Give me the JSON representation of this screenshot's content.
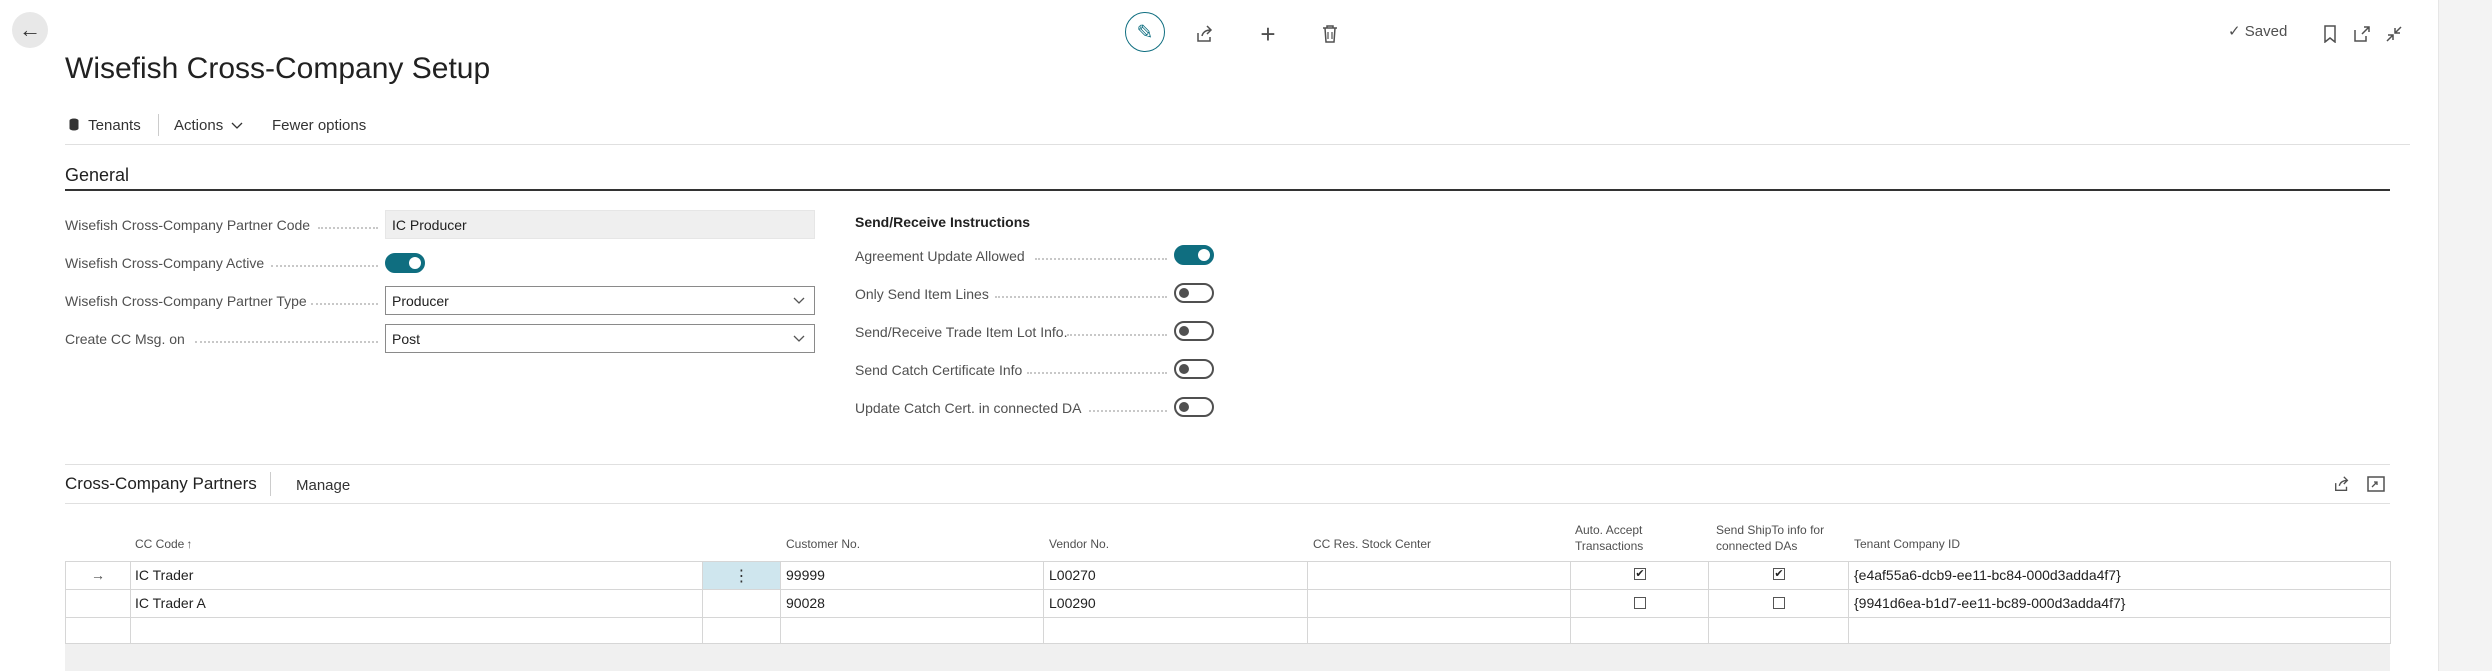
{
  "header": {
    "title": "Wisefish Cross-Company Setup",
    "saved_label": "Saved",
    "saved_check": "✓"
  },
  "actionbar": {
    "tenants_label": "Tenants",
    "actions_label": "Actions",
    "fewer_options_label": "Fewer options"
  },
  "general": {
    "section_title": "General",
    "partner_code_label": "Wisefish Cross-Company Partner Code",
    "partner_code_value": "IC Producer",
    "active_label": "Wisefish Cross-Company Active",
    "active_value": true,
    "partner_type_label": "Wisefish Cross-Company Partner Type",
    "partner_type_value": "Producer",
    "create_msg_label": "Create CC Msg. on",
    "create_msg_value": "Post"
  },
  "send_receive": {
    "heading": "Send/Receive Instructions",
    "items": [
      {
        "label": "Agreement Update Allowed",
        "on": true
      },
      {
        "label": "Only Send Item Lines",
        "on": false
      },
      {
        "label": "Send/Receive Trade Item Lot Info.",
        "on": false
      },
      {
        "label": "Send Catch Certificate Info",
        "on": false
      },
      {
        "label": "Update Catch Cert. in connected DA",
        "on": false
      }
    ]
  },
  "partners": {
    "title": "Cross-Company Partners",
    "manage_label": "Manage",
    "columns": {
      "cc_code": "CC Code",
      "sort_arrow": "↑",
      "customer_no": "Customer No.",
      "vendor_no": "Vendor No.",
      "cc_res_stock_center": "CC Res. Stock Center",
      "auto_accept_1": "Auto. Accept",
      "auto_accept_2": "Transactions",
      "send_shipto_1": "Send ShipTo info for",
      "send_shipto_2": "connected DAs",
      "tenant_company_id": "Tenant Company ID"
    },
    "rows": [
      {
        "cc_code": "IC Trader",
        "customer_no": "99999",
        "vendor_no": "L00270",
        "stock_center": "",
        "auto_accept": true,
        "send_shipto": true,
        "tenant_id": "{e4af55a6-dcb9-ee11-bc84-000d3adda4f7}"
      },
      {
        "cc_code": "IC Trader A",
        "customer_no": "90028",
        "vendor_no": "L00290",
        "stock_center": "",
        "auto_accept": false,
        "send_shipto": false,
        "tenant_id": "{9941d6ea-b1d7-ee11-bc89-000d3adda4f7}"
      }
    ]
  }
}
